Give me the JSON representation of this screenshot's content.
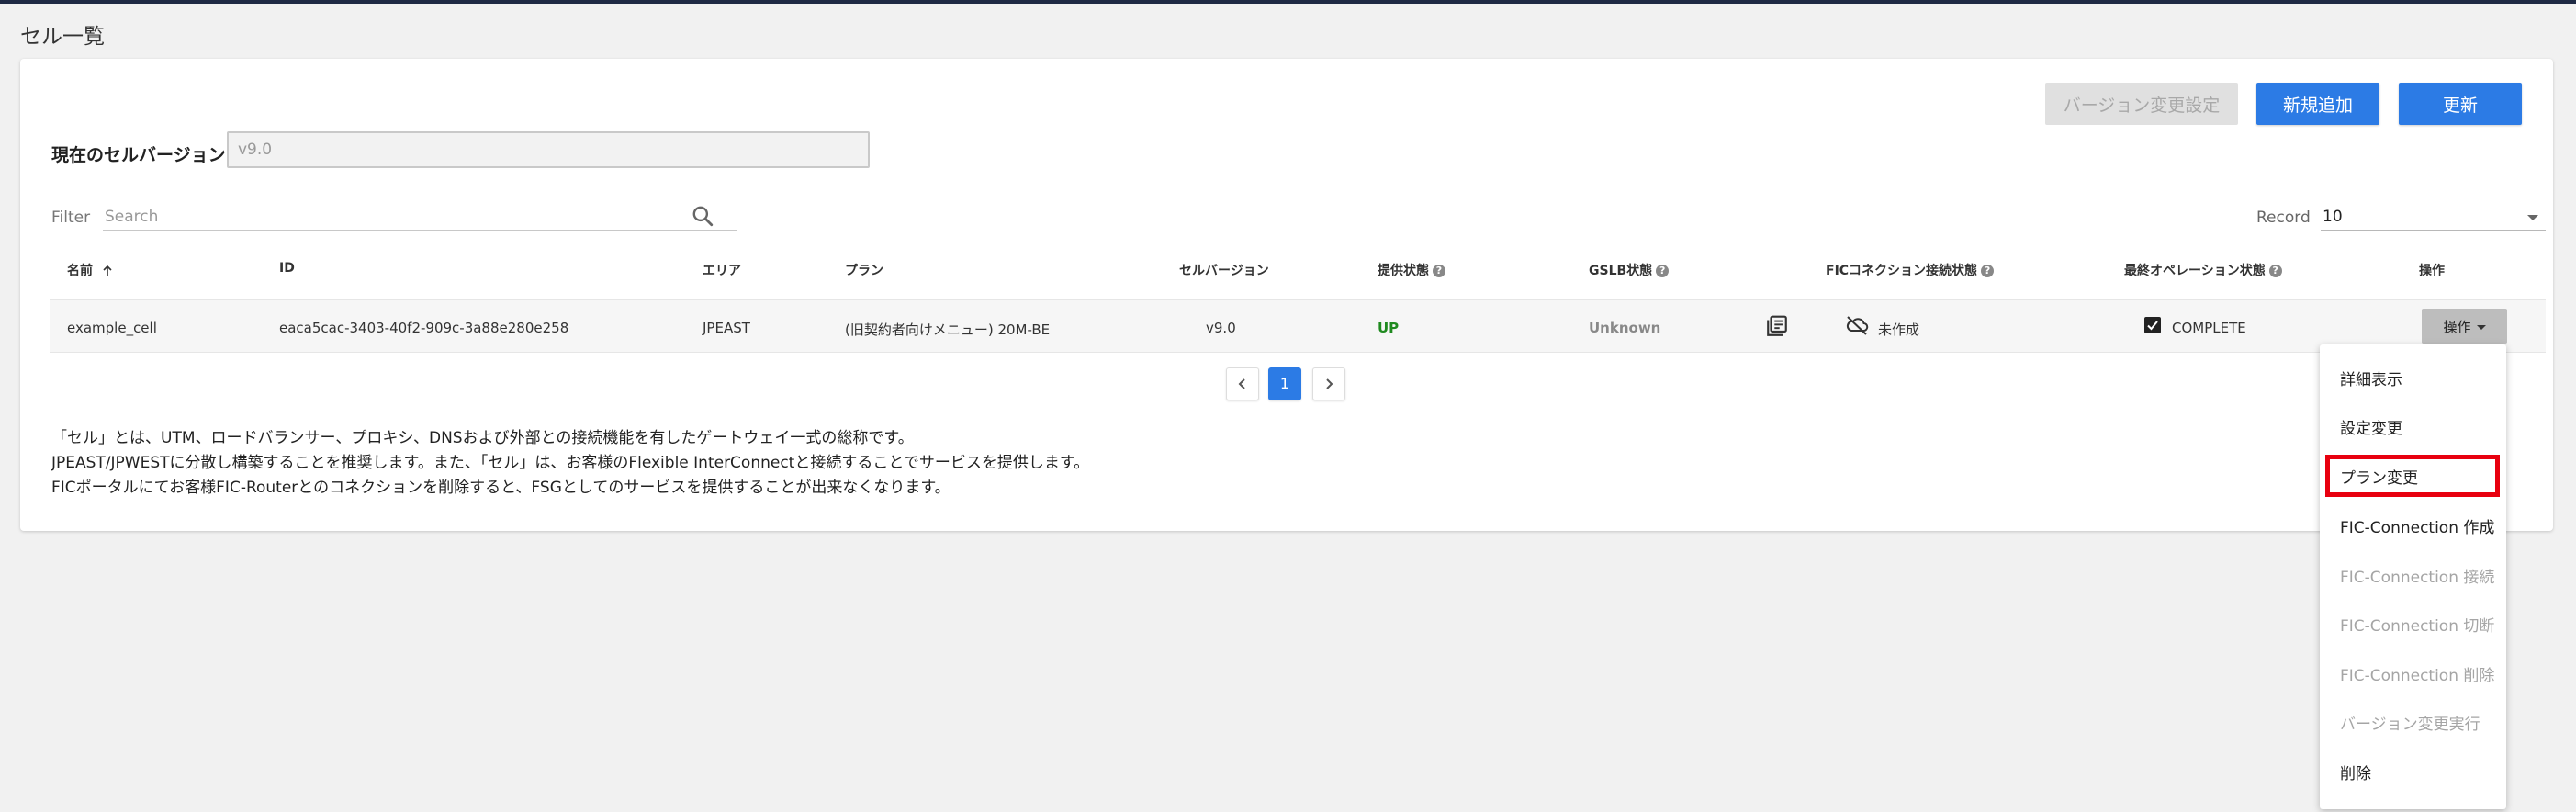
{
  "page": {
    "title": "セル一覧"
  },
  "toolbar": {
    "version_change_settings": "バージョン変更設定",
    "add_new": "新規追加",
    "refresh": "更新"
  },
  "cell_version": {
    "label": "現在のセルバージョン",
    "value": "v9.0"
  },
  "filter": {
    "label": "Filter",
    "placeholder": "Search"
  },
  "record": {
    "label": "Record",
    "value": "10"
  },
  "table": {
    "headers": {
      "name": "名前",
      "id": "ID",
      "area": "エリア",
      "plan": "プラン",
      "cell_version": "セルバージョン",
      "service_status": "提供状態",
      "gslb_status": "GSLB状態",
      "fic_status": "FICコネクション接続状態",
      "last_op_status": "最終オペレーション状態",
      "operation": "操作"
    },
    "rows": [
      {
        "name": "example_cell",
        "id": "eaca5cac-3403-40f2-909c-3a88e280e258",
        "area": "JPEAST",
        "plan": "(旧契約者向けメニュー) 20M-BE",
        "cell_version": "v9.0",
        "service_status": "UP",
        "gslb_status": "Unknown",
        "fic_status": "未作成",
        "last_op_status": "COMPLETE",
        "operation": "操作"
      }
    ]
  },
  "pagination": {
    "current": "1"
  },
  "description": {
    "line1": "「セル」とは、UTM、ロードバランサー、プロキシ、DNSおよび外部との接続機能を有したゲートウェイ一式の総称です。",
    "line2": "JPEAST/JPWESTに分散し構築することを推奨します。また、「セル」は、お客様のFlexible InterConnectと接続することでサービスを提供します。",
    "line3": "FICポータルにてお客様FIC-Routerとのコネクションを削除すると、FSGとしてのサービスを提供することが出来なくなります。"
  },
  "menu": {
    "items": [
      {
        "label": "詳細表示",
        "enabled": true
      },
      {
        "label": "設定変更",
        "enabled": true
      },
      {
        "label": "プラン変更",
        "enabled": true
      },
      {
        "label": "FIC-Connection 作成",
        "enabled": true
      },
      {
        "label": "FIC-Connection 接続",
        "enabled": false
      },
      {
        "label": "FIC-Connection 切断",
        "enabled": false
      },
      {
        "label": "FIC-Connection 削除",
        "enabled": false
      },
      {
        "label": "バージョン変更実行",
        "enabled": false
      },
      {
        "label": "削除",
        "enabled": true
      }
    ]
  },
  "colors": {
    "primary": "#2c7be5",
    "status_up": "#1f8a1f",
    "highlight": "#e8000f"
  }
}
